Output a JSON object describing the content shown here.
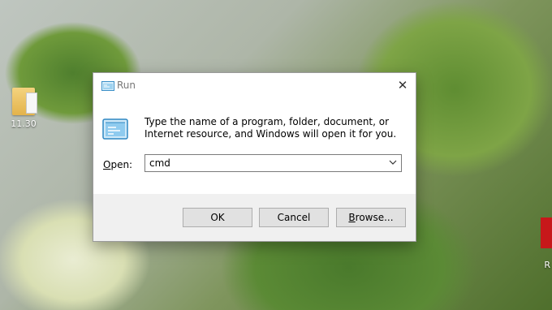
{
  "desktop": {
    "icons": [
      {
        "label": "11.30",
        "icon": "folder-icon"
      }
    ],
    "right_icon": {
      "label": "R",
      "icon": "application-icon"
    }
  },
  "dialog": {
    "title": "Run",
    "title_icon": "run-icon",
    "close_symbol": "✕",
    "description": "Type the name of a program, folder, document, or Internet resource, and Windows will open it for you.",
    "open_label_accel": "O",
    "open_label_rest": "pen:",
    "open_value": "cmd",
    "buttons": {
      "ok": "OK",
      "cancel": "Cancel",
      "browse_accel": "B",
      "browse_rest": "rowse..."
    }
  },
  "colors": {
    "dialog_background": "#ffffff",
    "button_bar": "#f0f0f0",
    "button_face": "#e1e1e1"
  }
}
